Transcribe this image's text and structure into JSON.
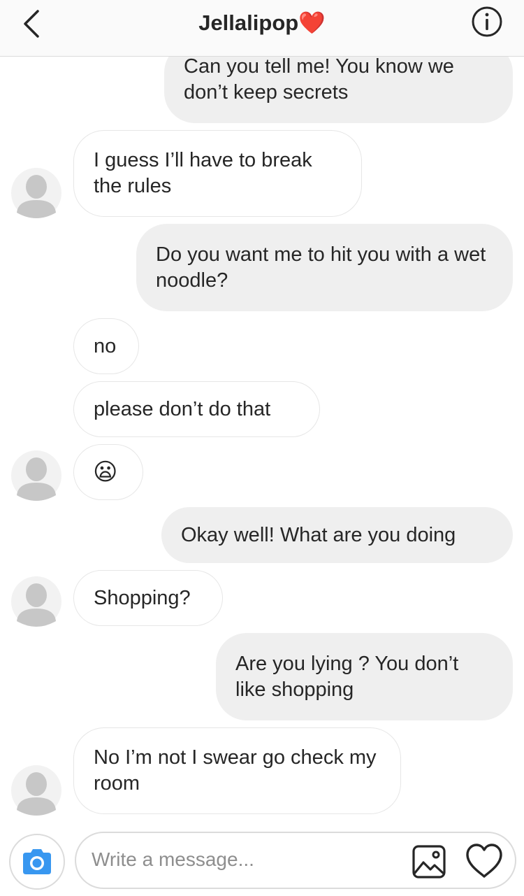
{
  "header": {
    "title": "Jellalipop",
    "title_emoji": "❤️",
    "back_icon": "chevron-left-icon",
    "info_icon": "info-icon"
  },
  "messages": [
    {
      "direction": "sent",
      "text": "Can you tell me! You know we don’t keep secrets"
    },
    {
      "direction": "received",
      "text": "I guess I’ll have to break the rules",
      "avatar": true
    },
    {
      "direction": "sent",
      "text": "Do you want me to hit you with a wet noodle?"
    },
    {
      "direction": "received",
      "text": "no"
    },
    {
      "direction": "received",
      "text": "please don’t do that"
    },
    {
      "direction": "received",
      "text": "😦",
      "avatar": true
    },
    {
      "direction": "sent",
      "text": "Okay well! What are you doing"
    },
    {
      "direction": "received",
      "text": "Shopping?",
      "avatar": true
    },
    {
      "direction": "sent",
      "text": "Are you lying ? You don’t like shopping"
    },
    {
      "direction": "received",
      "text": "No I’m not I swear go check my room",
      "avatar": true
    }
  ],
  "composer": {
    "placeholder": "Write a message...",
    "camera_icon": "camera-icon",
    "gallery_icon": "image-icon",
    "like_icon": "heart-icon"
  },
  "colors": {
    "header_bg": "#fafafa",
    "sent_bubble": "#efefef",
    "received_border": "#e6e6e6",
    "camera_blue": "#3897f0",
    "heart_red": "#e0313a"
  }
}
